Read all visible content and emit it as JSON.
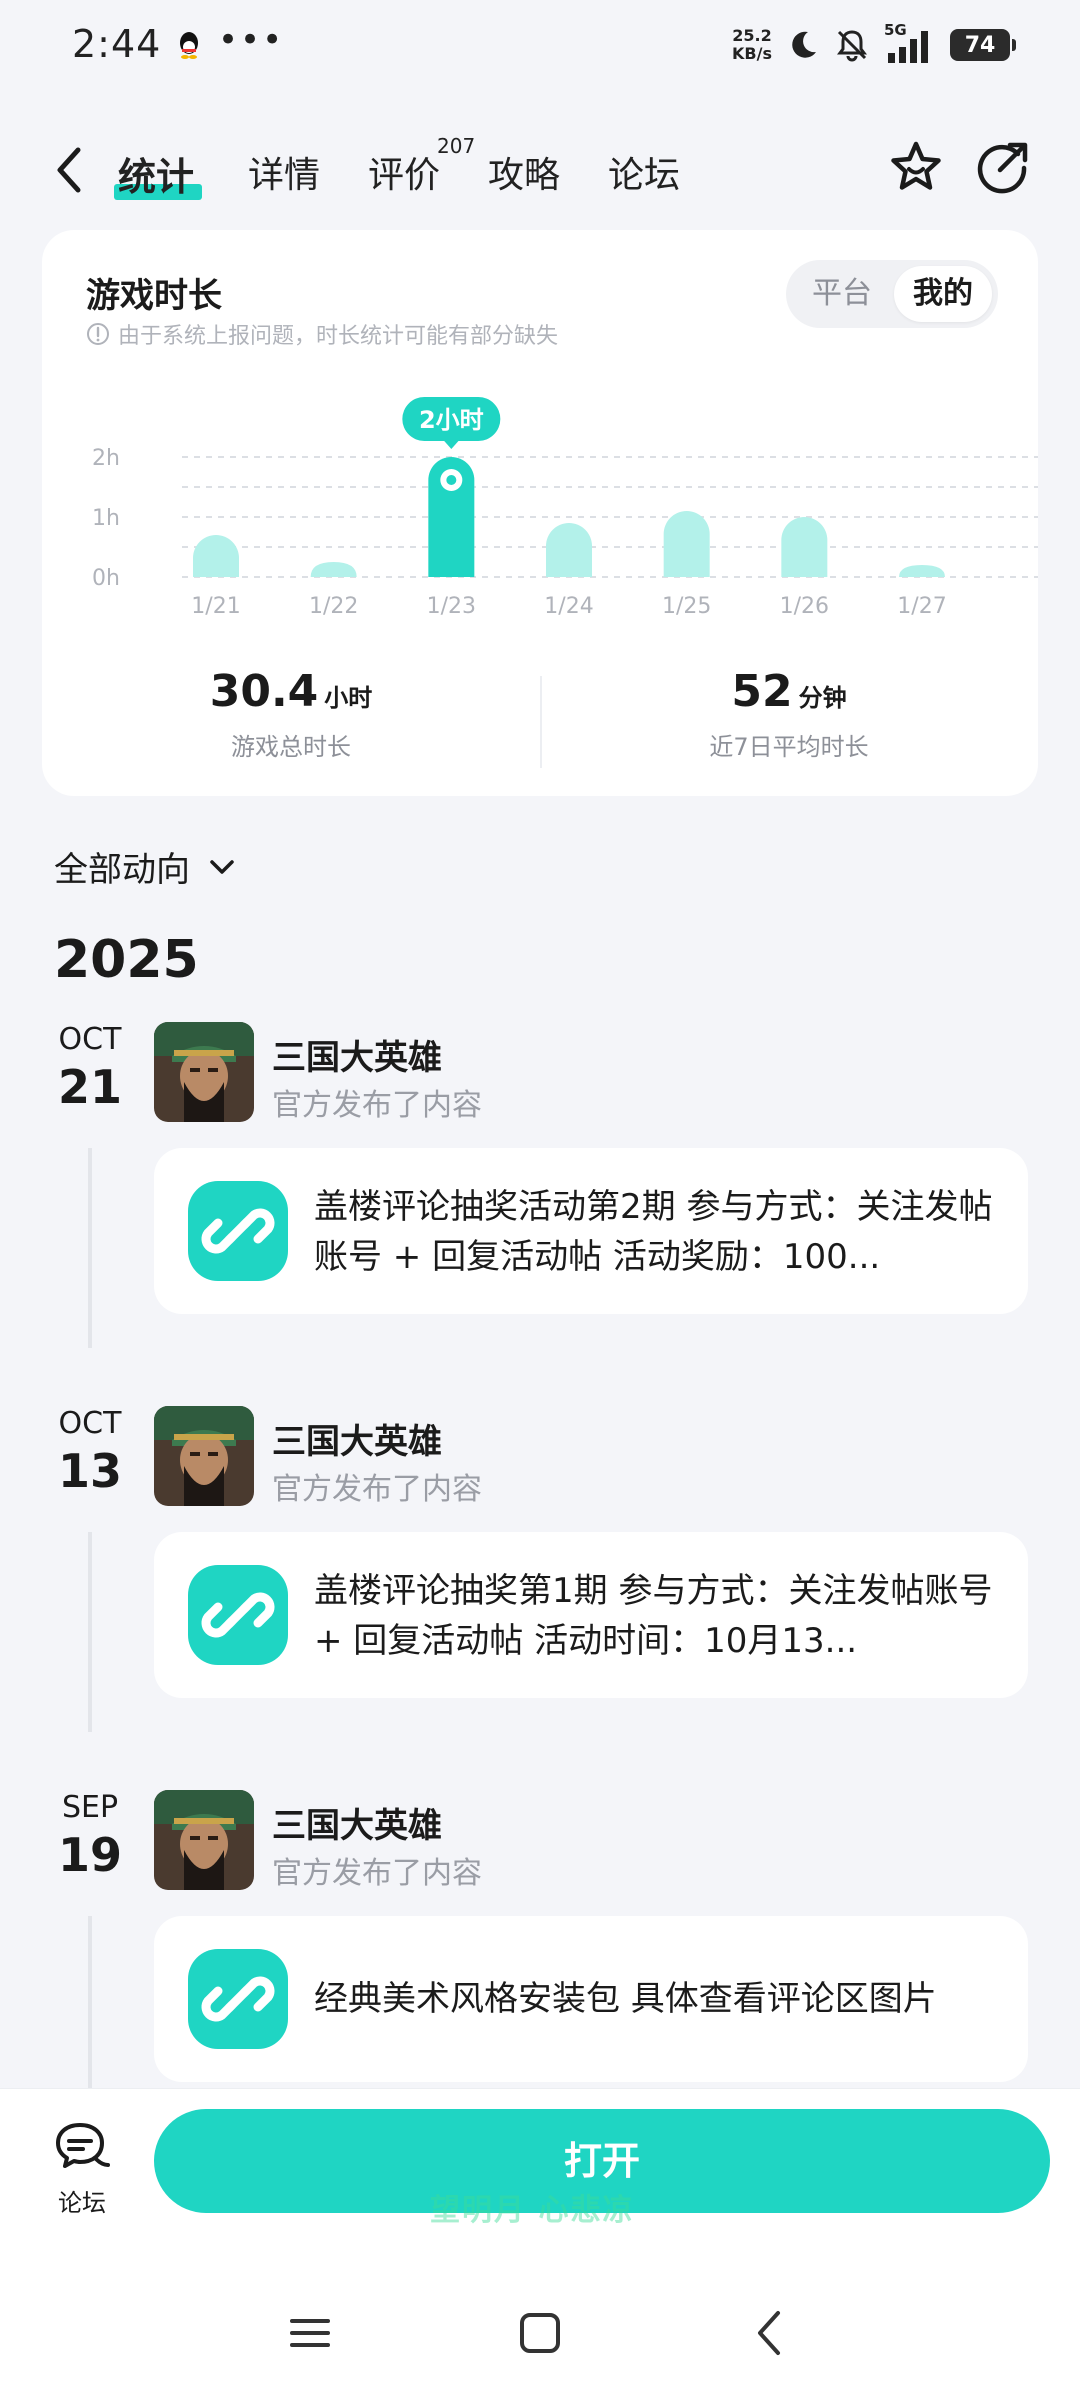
{
  "status_bar": {
    "time": "2:44",
    "dots": "•••",
    "net_speed_value": "25.2",
    "net_speed_unit": "KB/s",
    "network": "5G",
    "battery": "74"
  },
  "nav": {
    "tabs": [
      {
        "label": "统计",
        "active": true
      },
      {
        "label": "详情",
        "active": false
      },
      {
        "label": "评价",
        "active": false,
        "badge": "207"
      },
      {
        "label": "攻略",
        "active": false
      },
      {
        "label": "论坛",
        "active": false
      }
    ]
  },
  "stats_card": {
    "title": "游戏时长",
    "note": "由于系统上报问题，时长统计可能有部分缺失",
    "segment_options": [
      "平台",
      "我的"
    ],
    "segment_selected": "我的",
    "total": {
      "value": "30.4",
      "unit": "小时",
      "label": "游戏总时长"
    },
    "average": {
      "value": "52",
      "unit": "分钟",
      "label": "近7日平均时长"
    }
  },
  "chart_data": {
    "type": "bar",
    "categories": [
      "1/21",
      "1/22",
      "1/23",
      "1/24",
      "1/25",
      "1/26",
      "1/27"
    ],
    "values": [
      0.7,
      0.25,
      2.0,
      0.9,
      1.1,
      1.0,
      0.2
    ],
    "ylim": [
      0,
      2
    ],
    "y_ticks": [
      "0h",
      "1h",
      "2h"
    ],
    "y_tick_values": [
      0,
      1,
      2
    ],
    "highlight_index": 2,
    "highlight_label": "2小时",
    "grid": true,
    "colors": {
      "bar": "#b3f1ea",
      "highlight": "#1fd5c3"
    }
  },
  "feed": {
    "filter_label": "全部动向",
    "year": "2025",
    "items": [
      {
        "month": "OCT",
        "day": "21",
        "game": "三国大英雄",
        "action": "官方发布了内容",
        "text": "盖楼评论抽奖活动第2期 参与方式：关注发帖账号 + 回复活动帖  活动奖励：100..."
      },
      {
        "month": "OCT",
        "day": "13",
        "game": "三国大英雄",
        "action": "官方发布了内容",
        "text": "盖楼评论抽奖第1期 参与方式：关注发帖账号 + 回复活动帖  活动时间：10月13..."
      },
      {
        "month": "SEP",
        "day": "19",
        "game": "三国大英雄",
        "action": "官方发布了内容",
        "text": "经典美术风格安装包 具体查看评论区图片"
      }
    ]
  },
  "bottom_bar": {
    "forum_label": "论坛",
    "open_label": "打开",
    "watermark": "望明月 心悲凉"
  },
  "theme": {
    "accent": "#1fd5c3",
    "bar_light": "#b3f1ea"
  }
}
